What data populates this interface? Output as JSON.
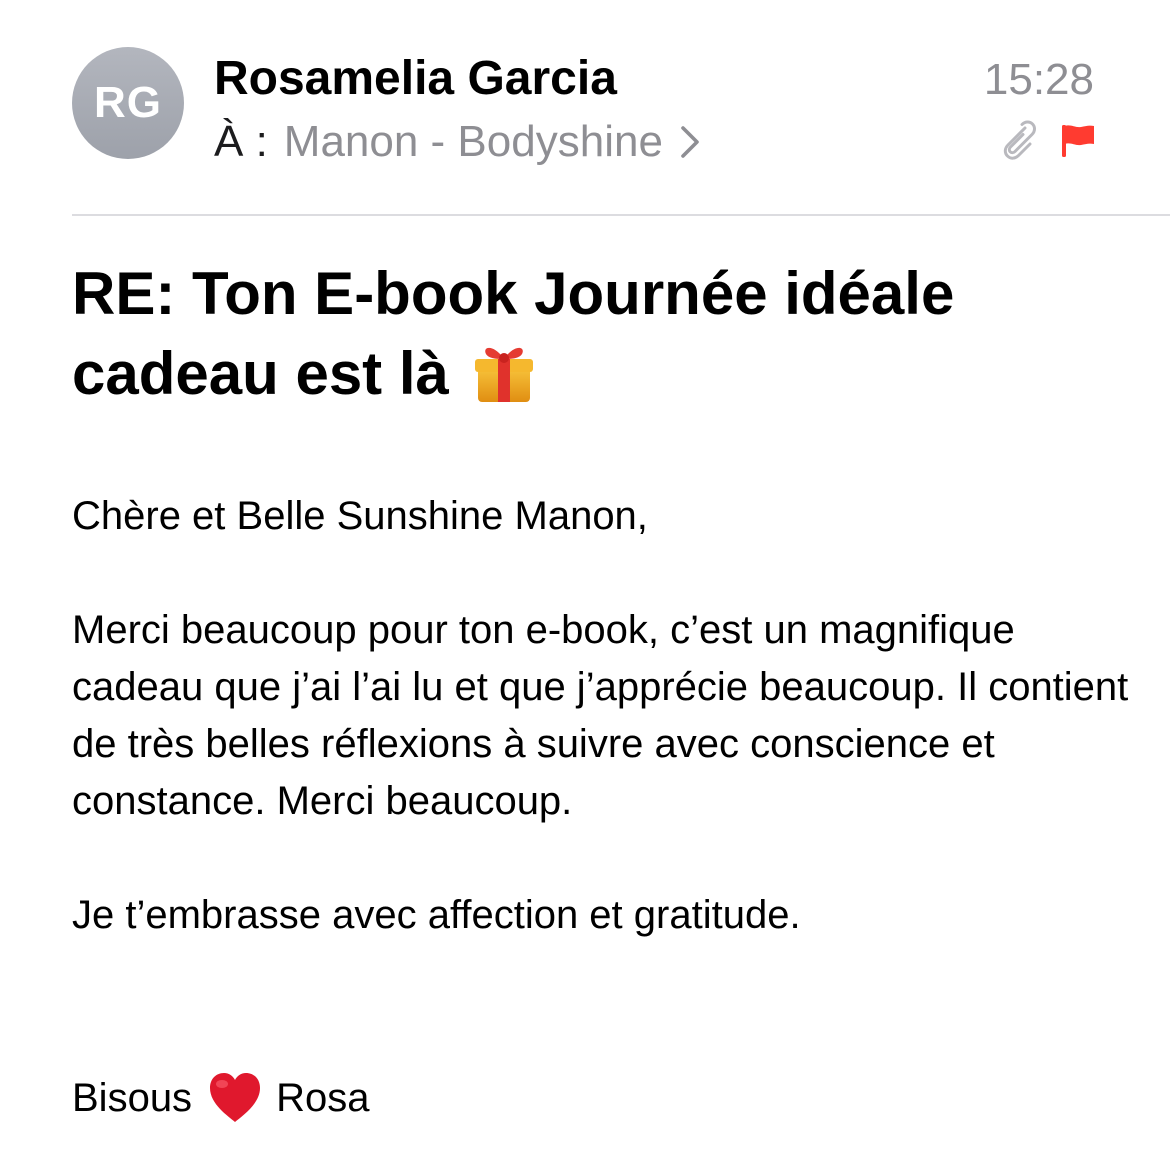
{
  "header": {
    "avatar_initials": "RG",
    "sender_name": "Rosamelia Garcia",
    "to_label": "À :",
    "recipient": "Manon - Bodyshine",
    "time": "15:28",
    "icons": {
      "chevron": "chevron-right-icon",
      "attachment": "paperclip-icon",
      "flag": "flag-icon"
    },
    "flag_color": "#ff3b30"
  },
  "subject": "RE: Ton E-book Journée idéale cadeau est là",
  "subject_emoji": "gift-icon",
  "body": {
    "greeting": "Chère et Belle Sunshine Manon,",
    "paragraph": "Merci beaucoup pour ton e-book, c’est un magnifique cadeau que j’ai l’ai lu et que j’apprécie beaucoup. Il contient de très belles réflexions à suivre avec conscience et constance. Merci beaucoup.",
    "closing": "Je t’embrasse avec affection et gratitude.",
    "signoff_prefix": "Bisous",
    "signoff_emoji": "heart-icon",
    "signoff_name": "Rosa"
  },
  "colors": {
    "secondary_text": "#8e8e93",
    "avatar_bg": "#a8abb3",
    "divider": "#dcdce0"
  }
}
